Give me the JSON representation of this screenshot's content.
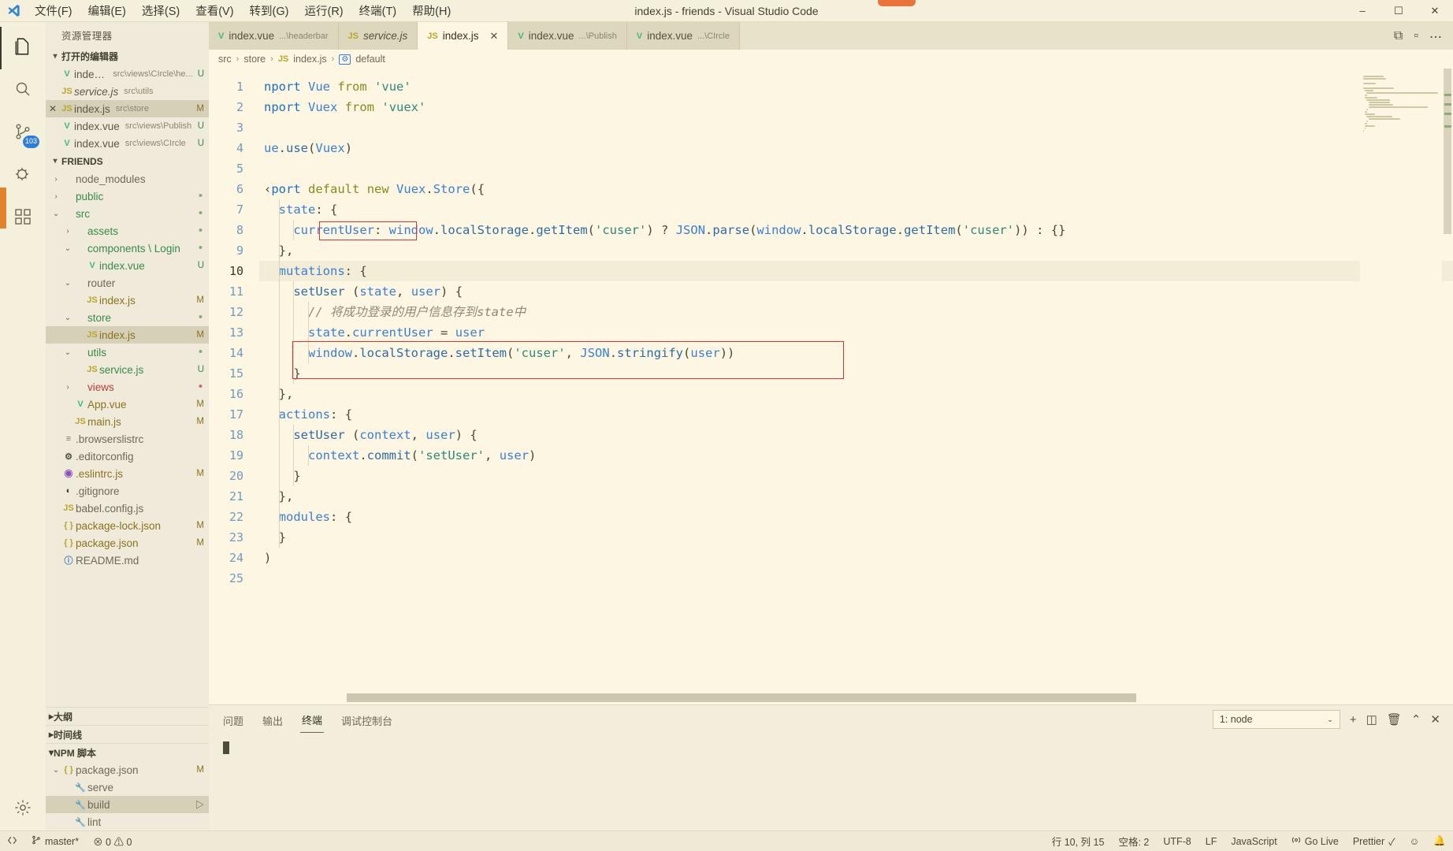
{
  "window": {
    "title": "index.js - friends - Visual Studio Code",
    "minimize": "–",
    "maximize": "☐",
    "close": "✕"
  },
  "menu": {
    "items": [
      {
        "label": "文件(F)"
      },
      {
        "label": "编辑(E)"
      },
      {
        "label": "选择(S)"
      },
      {
        "label": "查看(V)"
      },
      {
        "label": "转到(G)"
      },
      {
        "label": "运行(R)"
      },
      {
        "label": "终端(T)"
      },
      {
        "label": "帮助(H)"
      }
    ]
  },
  "activitybar": {
    "items": [
      {
        "name": "explorer",
        "icon": "files-icon",
        "active": true,
        "badge": ""
      },
      {
        "name": "search",
        "icon": "search-icon",
        "active": false,
        "badge": ""
      },
      {
        "name": "source-control",
        "icon": "source-control-icon",
        "active": false,
        "badge": "103"
      },
      {
        "name": "run-debug",
        "icon": "run-debug-icon",
        "active": false,
        "badge": ""
      },
      {
        "name": "extensions",
        "icon": "extensions-icon",
        "active": false,
        "badge": ""
      }
    ],
    "bottom": [
      {
        "name": "settings",
        "icon": "gear-icon"
      }
    ]
  },
  "sidebar": {
    "title": "资源管理器",
    "open_editors": {
      "header": "打开的编辑器",
      "items": [
        {
          "icon": "vue",
          "name": "index.vue",
          "path": "src\\views\\CIrcle\\he...",
          "state": "U",
          "active": false,
          "italic": false
        },
        {
          "icon": "js",
          "name": "service.js",
          "path": "src\\utils",
          "state": "",
          "active": false,
          "italic": true
        },
        {
          "icon": "js",
          "name": "index.js",
          "path": "src\\store",
          "state": "M",
          "active": true,
          "italic": false
        },
        {
          "icon": "vue",
          "name": "index.vue",
          "path": "src\\views\\Publish",
          "state": "U",
          "active": false,
          "italic": false
        },
        {
          "icon": "vue",
          "name": "index.vue",
          "path": "src\\views\\CIrcle",
          "state": "U",
          "active": false,
          "italic": false
        }
      ]
    },
    "project": {
      "header": "FRIENDS",
      "items": [
        {
          "indent": 1,
          "twisty": "collapsed",
          "icon": "none",
          "name": "node_modules",
          "color": "gray",
          "state": "",
          "selected": false
        },
        {
          "indent": 1,
          "twisty": "collapsed",
          "icon": "none",
          "name": "public",
          "color": "green",
          "state": "dot-green",
          "selected": false
        },
        {
          "indent": 1,
          "twisty": "expanded",
          "icon": "none",
          "name": "src",
          "color": "green",
          "state": "dot-green",
          "selected": false
        },
        {
          "indent": 2,
          "twisty": "collapsed",
          "icon": "none",
          "name": "assets",
          "color": "green",
          "state": "dot-green",
          "selected": false
        },
        {
          "indent": 2,
          "twisty": "expanded",
          "icon": "none",
          "name": "components \\ Login",
          "color": "green",
          "state": "dot-green",
          "selected": false
        },
        {
          "indent": 3,
          "twisty": "none",
          "icon": "vue",
          "name": "index.vue",
          "color": "green",
          "state": "U",
          "selected": false
        },
        {
          "indent": 2,
          "twisty": "expanded",
          "icon": "none",
          "name": "router",
          "color": "gray",
          "state": "",
          "selected": false
        },
        {
          "indent": 3,
          "twisty": "none",
          "icon": "js",
          "name": "index.js",
          "color": "mod",
          "state": "M",
          "selected": false
        },
        {
          "indent": 2,
          "twisty": "expanded",
          "icon": "none",
          "name": "store",
          "color": "green",
          "state": "dot-green",
          "selected": false
        },
        {
          "indent": 3,
          "twisty": "none",
          "icon": "js",
          "name": "index.js",
          "color": "mod",
          "state": "M",
          "selected": true
        },
        {
          "indent": 2,
          "twisty": "expanded",
          "icon": "none",
          "name": "utils",
          "color": "green",
          "state": "dot-green",
          "selected": false
        },
        {
          "indent": 3,
          "twisty": "none",
          "icon": "js",
          "name": "service.js",
          "color": "green",
          "state": "U",
          "selected": false
        },
        {
          "indent": 2,
          "twisty": "collapsed",
          "icon": "none",
          "name": "views",
          "color": "red",
          "state": "dot-red",
          "selected": false
        },
        {
          "indent": 2,
          "twisty": "none",
          "icon": "vue",
          "name": "App.vue",
          "color": "mod",
          "state": "M",
          "selected": false
        },
        {
          "indent": 2,
          "twisty": "none",
          "icon": "js",
          "name": "main.js",
          "color": "mod",
          "state": "M",
          "selected": false
        },
        {
          "indent": 1,
          "twisty": "none",
          "icon": "list",
          "name": ".browserslistrc",
          "color": "gray",
          "state": "",
          "selected": false
        },
        {
          "indent": 1,
          "twisty": "none",
          "icon": "gear",
          "name": ".editorconfig",
          "color": "gray",
          "state": "",
          "selected": false
        },
        {
          "indent": 1,
          "twisty": "none",
          "icon": "eslint",
          "name": ".eslintrc.js",
          "color": "mod",
          "state": "M",
          "selected": false
        },
        {
          "indent": 1,
          "twisty": "none",
          "icon": "git",
          "name": ".gitignore",
          "color": "gray",
          "state": "",
          "selected": false
        },
        {
          "indent": 1,
          "twisty": "none",
          "icon": "js",
          "name": "babel.config.js",
          "color": "gray",
          "state": "",
          "selected": false
        },
        {
          "indent": 1,
          "twisty": "none",
          "icon": "json",
          "name": "package-lock.json",
          "color": "mod",
          "state": "M",
          "selected": false
        },
        {
          "indent": 1,
          "twisty": "none",
          "icon": "json",
          "name": "package.json",
          "color": "mod",
          "state": "M",
          "selected": false
        },
        {
          "indent": 1,
          "twisty": "none",
          "icon": "md",
          "name": "README.md",
          "color": "gray",
          "state": "",
          "selected": false
        }
      ]
    },
    "outline": {
      "header": "大纲"
    },
    "timeline": {
      "header": "时间线"
    },
    "npm_scripts": {
      "header": "NPM 脚本",
      "items": [
        {
          "indent": 1,
          "twisty": "expanded",
          "icon": "json",
          "name": "package.json",
          "state": "M",
          "selected": false,
          "play": false
        },
        {
          "indent": 2,
          "twisty": "none",
          "icon": "wrench",
          "name": "serve",
          "state": "",
          "selected": false,
          "play": false
        },
        {
          "indent": 2,
          "twisty": "none",
          "icon": "wrench",
          "name": "build",
          "state": "",
          "selected": true,
          "play": true
        },
        {
          "indent": 2,
          "twisty": "none",
          "icon": "wrench",
          "name": "lint",
          "state": "",
          "selected": false,
          "play": false
        }
      ]
    }
  },
  "tabs": {
    "items": [
      {
        "icon": "vue",
        "name": "index.vue",
        "sub": "...\\headerbar",
        "active": false,
        "italic": false,
        "closable": false
      },
      {
        "icon": "js",
        "name": "service.js",
        "sub": "",
        "active": false,
        "italic": true,
        "closable": false
      },
      {
        "icon": "js",
        "name": "index.js",
        "sub": "",
        "active": true,
        "italic": false,
        "closable": true
      },
      {
        "icon": "vue",
        "name": "index.vue",
        "sub": "...\\Publish",
        "active": false,
        "italic": false,
        "closable": false
      },
      {
        "icon": "vue",
        "name": "index.vue",
        "sub": "...\\CIrcle",
        "active": false,
        "italic": false,
        "closable": false
      }
    ],
    "close_glyph": "✕",
    "actions": [
      {
        "name": "split-editor-icon",
        "glyph": "⧉"
      },
      {
        "name": "open-changes-icon",
        "glyph": "▫"
      },
      {
        "name": "more-actions-icon",
        "glyph": "⋯"
      }
    ]
  },
  "breadcrumbs": {
    "parts": [
      "src",
      "store",
      "index.js",
      "default"
    ],
    "separator": "›",
    "js_badge": "JS",
    "symbol_badge": "⚙"
  },
  "editor": {
    "lines": [
      {
        "n": 1,
        "text": "nport Vue from 'vue'"
      },
      {
        "n": 2,
        "text": "nport Vuex from 'vuex'"
      },
      {
        "n": 3,
        "text": ""
      },
      {
        "n": 4,
        "text": "ue.use(Vuex)"
      },
      {
        "n": 5,
        "text": ""
      },
      {
        "n": 6,
        "text": "‹port default new Vuex.Store({"
      },
      {
        "n": 7,
        "text": "  state: {"
      },
      {
        "n": 8,
        "text": "    currentUser: window.localStorage.getItem('cuser') ? JSON.parse(window.localStorage.getItem('cuser')) : {}"
      },
      {
        "n": 9,
        "text": "  },"
      },
      {
        "n": 10,
        "text": "  mutations: {"
      },
      {
        "n": 11,
        "text": "    setUser (state, user) {"
      },
      {
        "n": 12,
        "text": "      // 将成功登录的用户信息存到state中"
      },
      {
        "n": 13,
        "text": "      state.currentUser = user"
      },
      {
        "n": 14,
        "text": "      window.localStorage.setItem('cuser', JSON.stringify(user))"
      },
      {
        "n": 15,
        "text": "    }"
      },
      {
        "n": 16,
        "text": "  },"
      },
      {
        "n": 17,
        "text": "  actions: {"
      },
      {
        "n": 18,
        "text": "    setUser (context, user) {"
      },
      {
        "n": 19,
        "text": "      context.commit('setUser', user)"
      },
      {
        "n": 20,
        "text": "    }"
      },
      {
        "n": 21,
        "text": "  },"
      },
      {
        "n": 22,
        "text": "  modules: {"
      },
      {
        "n": 23,
        "text": "  }"
      },
      {
        "n": 24,
        "text": ")"
      },
      {
        "n": 25,
        "text": ""
      }
    ],
    "current_line": 10,
    "annotations": [
      {
        "name": "highlight-currentuser",
        "line": 8,
        "color": "#e03232"
      },
      {
        "name": "highlight-setitem",
        "line": 14,
        "color": "#e03232"
      }
    ]
  },
  "panel": {
    "tabs": [
      {
        "label": "问题",
        "active": false
      },
      {
        "label": "输出",
        "active": false
      },
      {
        "label": "终端",
        "active": true
      },
      {
        "label": "调试控制台",
        "active": false
      }
    ],
    "terminal_select": "1: node",
    "caret_glyph": "⌄",
    "actions": [
      {
        "name": "new-terminal-icon",
        "glyph": "+"
      },
      {
        "name": "split-terminal-icon",
        "glyph": "◫"
      },
      {
        "name": "kill-terminal-icon",
        "glyph": "🗑"
      },
      {
        "name": "maximize-panel-icon",
        "glyph": "⌃"
      },
      {
        "name": "close-panel-icon",
        "glyph": "✕"
      }
    ]
  },
  "statusbar": {
    "left": [
      {
        "name": "remote-indicator",
        "glyph": "⎇",
        "label": ""
      },
      {
        "name": "branch-indicator",
        "glyph": "⎇",
        "label": "master*"
      },
      {
        "name": "problems-indicator",
        "glyph": "⊗ 0 ⚠ 0",
        "label": ""
      }
    ],
    "right": [
      {
        "name": "cursor-position",
        "label": "行 10, 列 15"
      },
      {
        "name": "indentation",
        "label": "空格: 2"
      },
      {
        "name": "encoding",
        "label": "UTF-8"
      },
      {
        "name": "eol",
        "label": "LF"
      },
      {
        "name": "language-mode",
        "label": "JavaScript"
      },
      {
        "name": "go-live",
        "label": "Go Live"
      },
      {
        "name": "prettier",
        "label": "Prettier"
      },
      {
        "name": "feedback",
        "label": "☺"
      },
      {
        "name": "notifications",
        "label": "🔔"
      }
    ]
  }
}
